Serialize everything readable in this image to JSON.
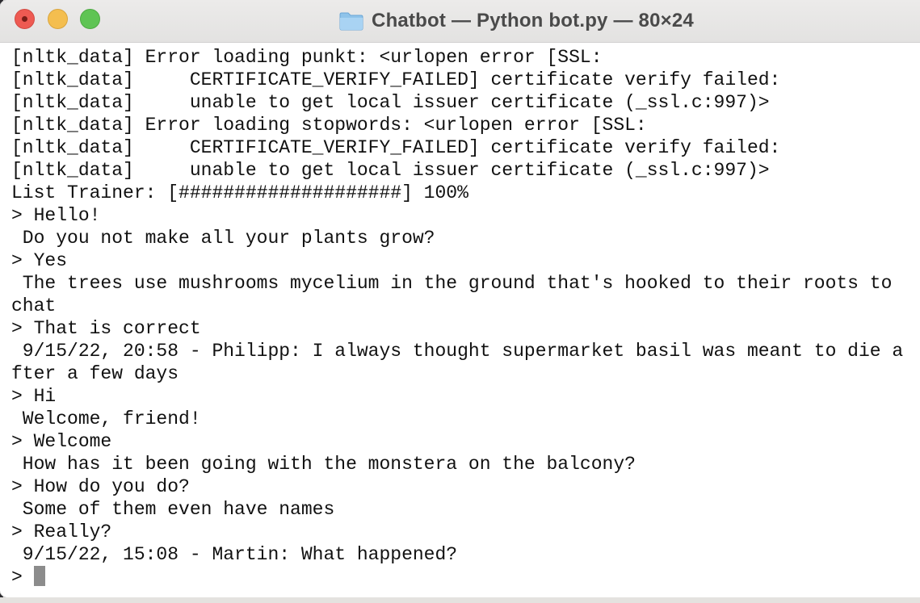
{
  "window": {
    "title": "Chatbot — Python bot.py — 80×24",
    "title_icon": "folder-icon"
  },
  "terminal": {
    "lines": [
      "[nltk_data] Error loading punkt: <urlopen error [SSL:",
      "[nltk_data]     CERTIFICATE_VERIFY_FAILED] certificate verify failed:",
      "[nltk_data]     unable to get local issuer certificate (_ssl.c:997)>",
      "[nltk_data] Error loading stopwords: <urlopen error [SSL:",
      "[nltk_data]     CERTIFICATE_VERIFY_FAILED] certificate verify failed:",
      "[nltk_data]     unable to get local issuer certificate (_ssl.c:997)>",
      "List Trainer: [####################] 100%",
      "> Hello!",
      " Do you not make all your plants grow?",
      "> Yes",
      " The trees use mushrooms mycelium in the ground that's hooked to their roots to",
      "chat",
      "> That is correct",
      " 9/15/22, 20:58 - Philipp: I always thought supermarket basil was meant to die a",
      "fter a few days",
      "> Hi",
      " Welcome, friend!",
      "> Welcome",
      " How has it been going with the monstera on the balcony?",
      "> How do you do?",
      " Some of them even have names",
      "> Really?",
      " 9/15/22, 15:08 - Martin: What happened?"
    ],
    "prompt": "> "
  },
  "colors": {
    "close": "#ee5a52",
    "minimize": "#f4be4f",
    "zoom": "#5fc454",
    "cursor": "#8c8c8c"
  }
}
